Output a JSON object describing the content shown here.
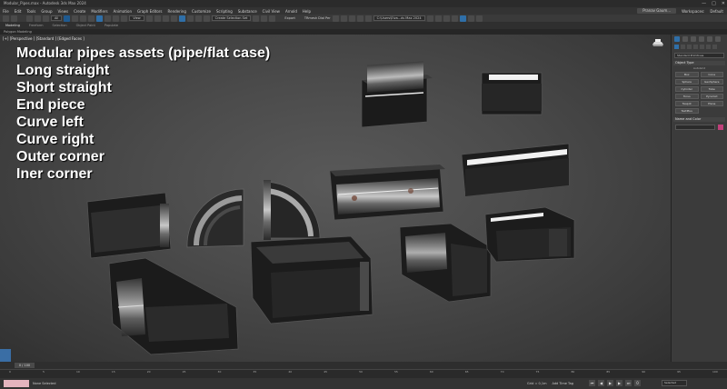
{
  "window": {
    "title": "Modular_Pipes.max - Autodesk 3ds Max 2024",
    "controls": [
      "—",
      "□",
      "✕"
    ]
  },
  "menu": {
    "items": [
      "File",
      "Edit",
      "Tools",
      "Group",
      "Views",
      "Create",
      "Modifiers",
      "Animation",
      "Graph Editors",
      "Rendering",
      "Customize",
      "Scripting",
      "Substance",
      "Civil View",
      "Arnold",
      "Help"
    ],
    "user": "Pranav Gaum...",
    "workspaces_label": "Workspaces:",
    "workspace_value": "Default"
  },
  "toolbar": {
    "filter_select": "All",
    "view_select": "View",
    "selection_set": "Create Selection Set",
    "export_label": "Export",
    "tri_label": "TRmesh Dial Per",
    "project_path": "C:\\Users\\Eiva...ds Max 2024"
  },
  "ribbon": {
    "tabs": [
      "Modeling",
      "Freeform",
      "Selection",
      "Object Paint",
      "Populate"
    ],
    "sub_label": "Polygon Modeling"
  },
  "viewport": {
    "label": "[+] [Perspective ] [Standard ] [Edged Faces ]",
    "overlay_lines": [
      "Modular pipes assets (pipe/flat case)",
      "Long straight",
      "Short straight",
      "End piece",
      "Curve left",
      "Curve right",
      "Outer corner",
      "Iner corner"
    ]
  },
  "command_panel": {
    "dropdown": "Standard Primitives",
    "object_type_title": "Object Type",
    "autogrid": "AutoGrid",
    "buttons": [
      "Box",
      "Cone",
      "Sphere",
      "GeoSphere",
      "Cylinder",
      "Tube",
      "Torus",
      "Pyramid",
      "Teapot",
      "Plane",
      "TextPlus"
    ],
    "name_color_title": "Name and Color"
  },
  "timeline": {
    "slider_label": "0 / 100",
    "ticks": [
      "0",
      "5",
      "10",
      "15",
      "20",
      "25",
      "30",
      "35",
      "40",
      "45",
      "50",
      "55",
      "60",
      "65",
      "70",
      "75",
      "80",
      "85",
      "90",
      "95",
      "100"
    ]
  },
  "status": {
    "selection": "None Selected",
    "grid": "Grid = 0,1m",
    "add_time_tag": "Add Time Tag",
    "selected_dropdown": "Selected",
    "frame": "0"
  },
  "colors": {
    "accent": "#2f6fa8",
    "viewport_center": "#595959",
    "swatch": "#c0407a"
  }
}
